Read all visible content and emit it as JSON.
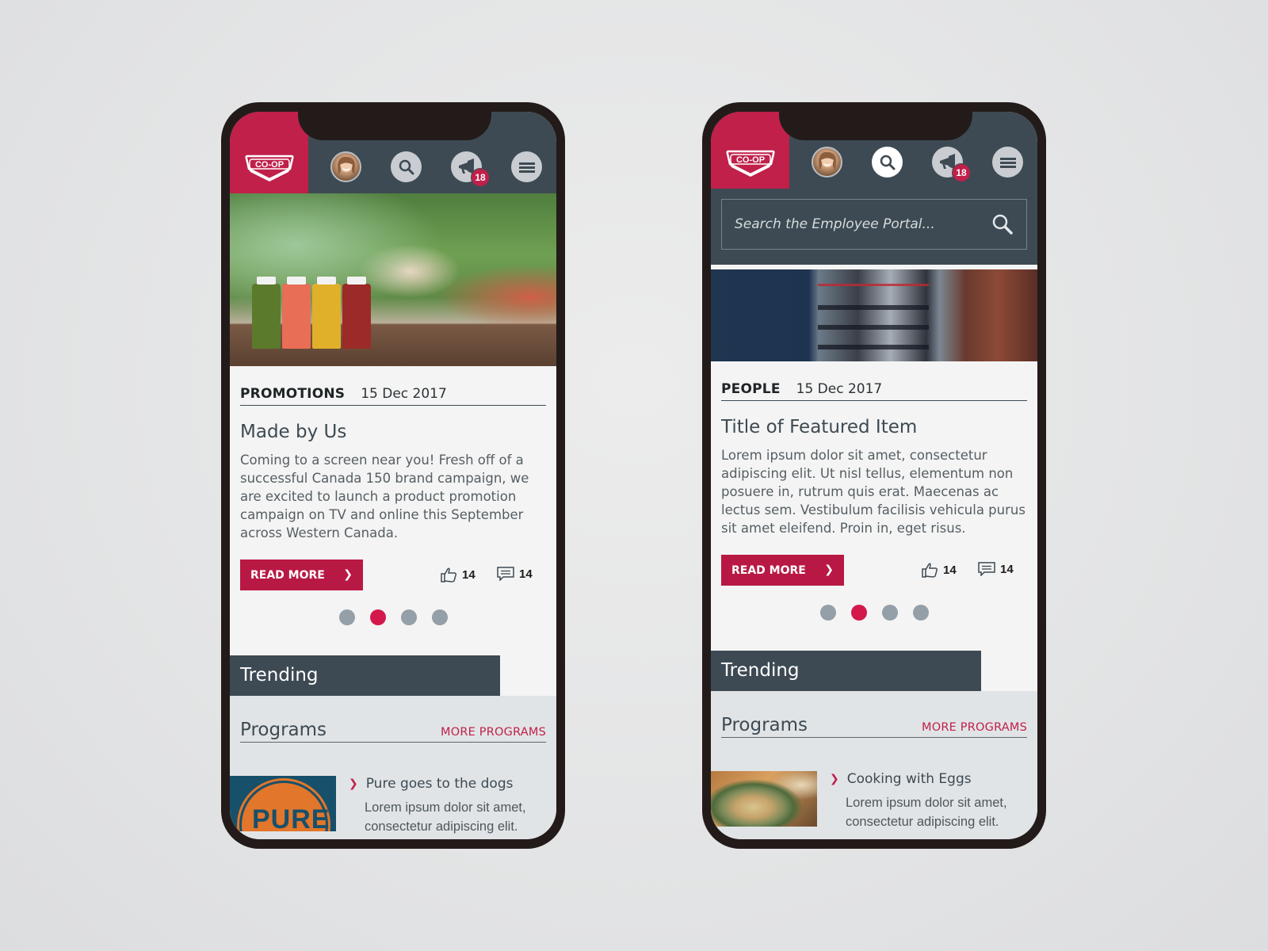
{
  "brand": {
    "logo_text": "CO-OP",
    "primary_color": "#c0204a",
    "header_color": "#3d4a53",
    "inactive_dot_color": "#949fa8"
  },
  "header": {
    "icons": [
      "avatar",
      "search-icon",
      "megaphone-icon",
      "menu-icon"
    ],
    "notification_count": "18"
  },
  "screens": [
    {
      "search_open": false,
      "hero_image": "juice-bottles-outdoor-photo",
      "featured": {
        "category": "PROMOTIONS",
        "date": "15 Dec 2017",
        "title": "Made by Us",
        "excerpt": "Coming to a screen near you! Fresh off of a successful Canada 150 brand campaign, we are excited to launch a product promotion campaign on TV and online this September across Western Canada.",
        "read_more_label": "READ MORE",
        "likes": "14",
        "comments": "14"
      },
      "carousel": {
        "total": 4,
        "active_index": 1
      },
      "trending_label": "Trending",
      "programs": {
        "title": "Programs",
        "more_label": "MORE PROGRAMS",
        "items": [
          {
            "title": "Pure goes to the dogs",
            "desc": "Lorem ipsum dolor sit amet, consectetur adipiscing elit.",
            "thumb_text": "PURE"
          }
        ]
      }
    },
    {
      "search_open": true,
      "search_placeholder": "Search the Employee Portal...",
      "hero_image": "three-employees-photo",
      "featured": {
        "category": "PEOPLE",
        "date": "15 Dec 2017",
        "title": "Title of Featured Item",
        "excerpt": "Lorem ipsum dolor sit amet, consectetur adipiscing elit. Ut nisl tellus, elementum non posuere in, rutrum quis erat. Maecenas ac lectus sem. Vestibulum facilisis vehicula purus sit amet eleifend. Proin in, eget risus.",
        "read_more_label": "READ MORE",
        "likes": "14",
        "comments": "14"
      },
      "carousel": {
        "total": 4,
        "active_index": 1
      },
      "trending_label": "Trending",
      "programs": {
        "title": "Programs",
        "more_label": "MORE PROGRAMS",
        "items": [
          {
            "title": "Cooking with Eggs",
            "desc": "Lorem ipsum dolor sit amet, consectetur adipiscing elit."
          }
        ]
      }
    }
  ]
}
